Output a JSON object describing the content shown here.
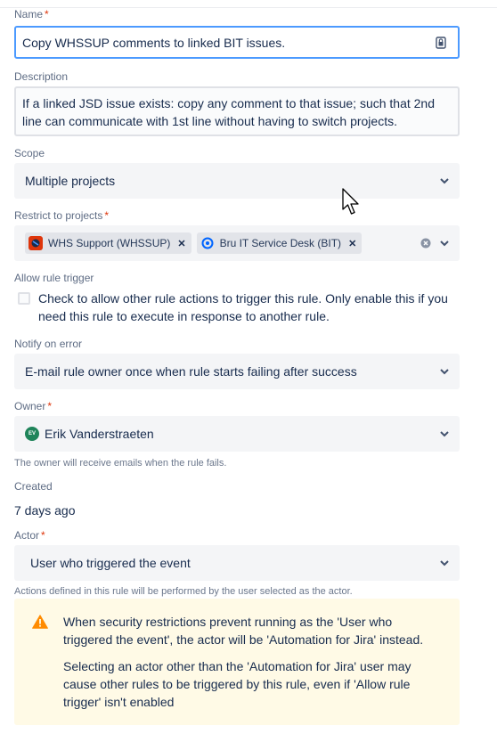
{
  "form": {
    "name": {
      "label": "Name",
      "value": "Copy WHSSUP comments to linked BIT issues."
    },
    "description": {
      "label": "Description",
      "value": "If a linked JSD issue exists: copy any comment to that issue; such that 2nd line can communicate with 1st line without having to switch projects."
    },
    "scope": {
      "label": "Scope",
      "value": "Multiple projects"
    },
    "restrict_projects": {
      "label": "Restrict to projects",
      "chips": [
        {
          "label": "WHS Support (WHSSUP)",
          "icon": "whs-project-icon"
        },
        {
          "label": "Bru IT Service Desk (BIT)",
          "icon": "bit-project-icon"
        }
      ]
    },
    "allow_trigger": {
      "label": "Allow rule trigger",
      "checkbox_text": "Check to allow other rule actions to trigger this rule. Only enable this if you need this rule to execute in response to another rule.",
      "checked": false
    },
    "notify": {
      "label": "Notify on error",
      "value": "E-mail rule owner once when rule starts failing after success"
    },
    "owner": {
      "label": "Owner",
      "avatar_initials": "EV",
      "value": "Erik Vanderstraeten",
      "help": "The owner will receive emails when the rule fails."
    },
    "created": {
      "label": "Created",
      "value": "7 days ago"
    },
    "actor": {
      "label": "Actor",
      "value": "User who triggered the event",
      "help": "Actions defined in this rule will be performed by the user selected as the actor."
    },
    "warning": {
      "p1": "When security restrictions prevent running as the 'User who triggered the event', the actor will be 'Automation for Jira' instead.",
      "p2": "Selecting an actor other than the 'Automation for Jira' user may cause other rules to be triggered by this rule, even if 'Allow rule trigger' isn't enabled"
    },
    "required_marker": "*"
  },
  "colors": {
    "focus_border": "#4c9aff",
    "required": "#de350b",
    "warning_bg": "#fffae6",
    "warning_icon": "#ff8b00",
    "avatar_bg": "#1f845a"
  }
}
